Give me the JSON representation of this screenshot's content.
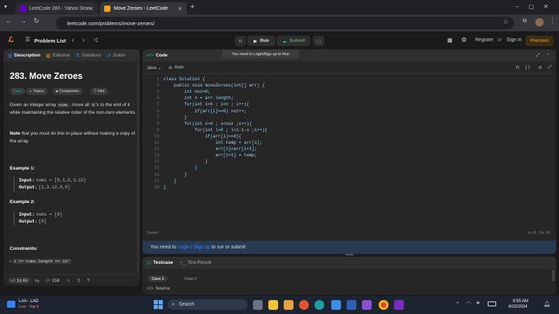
{
  "browser": {
    "tabs": [
      {
        "label": "LeetCode 283 - Yahoo Search Re",
        "active": false
      },
      {
        "label": "Move Zeroes - LeetCode",
        "active": true
      }
    ],
    "new_tab": "+",
    "url": "leetcode.com/problems/move-zeroes/"
  },
  "lc_header": {
    "problem_list": "Problem List",
    "run": "Run",
    "submit": "Submit",
    "tooltip": "You need to Login/Sign up to Run",
    "register": "Register",
    "or": "or",
    "sign_in": "Sign in",
    "premium": "Premium"
  },
  "left_panel": {
    "tabs": [
      "Description",
      "Editorial",
      "Solutions",
      "Subm"
    ],
    "title": "283. Move Zeroes",
    "tags": [
      "Easy",
      "Topics",
      "Companies",
      "Hint"
    ],
    "desc_part1": "Given an integer array ",
    "desc_code1": "nums",
    "desc_part2": ", move all ",
    "desc_code2": "0",
    "desc_part3": "'s to the end of it while maintaining the relative order of the non-zero elements.",
    "note_bold": "Note",
    "note_rest": " that you must do this in-place without making a copy of the array.",
    "example1_title": "Example 1:",
    "example1_input_label": "Input:",
    "example1_input": "nums = [0,1,0,3,12]",
    "example1_output_label": "Output:",
    "example1_output": "[1,3,12,0,0]",
    "example2_title": "Example 2:",
    "example2_input_label": "Input:",
    "example2_input": "nums = [0]",
    "example2_output_label": "Output:",
    "example2_output": "[0]",
    "constraints_title": "Constraints:",
    "constraint1": "1 <= nums.length <= 10⁴",
    "likes": "16.6K",
    "comments": "158"
  },
  "editor": {
    "header": "Code",
    "language": "Java",
    "mode": "Auto",
    "saved": "Saved",
    "cursor": "Ln 8, Col 34",
    "login_prefix": "You need to ",
    "login_link": "Login / Sign up",
    "login_suffix": " to run or submit",
    "lines": [
      "class Solution {",
      "    public void moveZeroes(int[] arr) {",
      "        int noz=0;",
      "        int n = arr.length;",
      "        for(int i=0 ; i<n ; i++){",
      "            if(arr[i]==0) noz++;",
      "        }",
      "        for(int x=0 ; x<noz ;x++){",
      "            for(int l=0 ; l<i-1-x ;i++){",
      "                if(arr[i]==0){",
      "                    int temp = arr[i];",
      "                    arr[i]=arr[i+1];",
      "                    arr[i+1] = temp;",
      "                }",
      "            }",
      "        }",
      "    }",
      "}"
    ]
  },
  "testcase": {
    "tab_testcase": "Testcase",
    "tab_result": "Test Result",
    "case1": "Case 1",
    "case2": "Case 2",
    "source": "Source"
  },
  "taskbar": {
    "weather_title": "LAA - LAD",
    "weather_sub": "Live - Top 9",
    "search": "Search",
    "time": "9:55 AM",
    "date": "6/22/2024"
  },
  "colors": {
    "accent_green": "#2cbb5d",
    "premium": "#ffa116",
    "link_blue": "#3b82f6",
    "easy": "#00b8a3"
  }
}
